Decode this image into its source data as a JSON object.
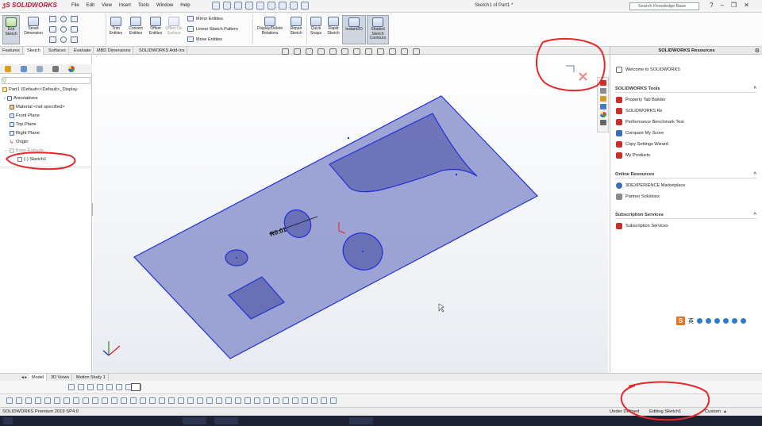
{
  "app": {
    "logo": "SOLIDWORKS",
    "doc_title": "Sketch1 of Part1 *"
  },
  "menu": [
    "File",
    "Edit",
    "View",
    "Insert",
    "Tools",
    "Window",
    "Help"
  ],
  "search": {
    "placeholder": "Search Knowledge Base"
  },
  "toolbar": {
    "exit_sketch": "Exit Sketch",
    "smart_dimension": "Smart Dimension",
    "trim_entities": "Trim Entities",
    "convert_entities": "Convert Entities",
    "offset_entities": "Offset Entities",
    "offset_on_surface": "Offset On Surface",
    "mirror_entities": "Mirror Entities",
    "linear_sketch_pattern": "Linear Sketch Pattern",
    "move_entities": "Move Entities",
    "display_delete_relations": "Display/Delete Relations",
    "repair_sketch": "Repair Sketch",
    "quick_snaps": "Quick Snaps",
    "rapid_sketch": "Rapid Sketch",
    "instant2d": "Instant2D",
    "shaded_sketch_contours": "Shaded Sketch Contours"
  },
  "cmd_tabs": [
    "Features",
    "Sketch",
    "Surfaces",
    "Evaluate",
    "MBD Dimensions",
    "SOLIDWORKS Add-Ins"
  ],
  "tree": {
    "part": "Part1  (Default<<Default>_Display",
    "annotations": "Annotations",
    "material": "Material <not specified>",
    "front_plane": "Front Plane",
    "top_plane": "Top Plane",
    "right_plane": "Right Plane",
    "origin": "Origin",
    "base_extrude": "Base-Extrude",
    "sketch": "(-) Sketch1"
  },
  "viewport": {
    "dimension_label": "R0.01"
  },
  "resources": {
    "title": "SOLIDWORKS Resources",
    "welcome": "Welcome to SOLIDWORKS",
    "tools_header": "SOLIDWORKS Tools",
    "tools": [
      "Property Tab Builder",
      "SOLIDWORKS Rx",
      "Performance Benchmark Test",
      "Compare My Score",
      "Copy Settings Wizard",
      "My Products"
    ],
    "online_header": "Online Resources",
    "online": [
      "3DEXPERIENCE Marketplace",
      "Partner Solutions"
    ],
    "subscription_header": "Subscription Services",
    "subscription": [
      "Subscription Services"
    ]
  },
  "tray": {
    "s5": "S",
    "lang": "英"
  },
  "bottom_tabs": [
    "Model",
    "3D Views",
    "Motion Study 1"
  ],
  "status": {
    "product": "SOLIDWORKS Premium 2019 SP4.0",
    "defined": "Under Defined",
    "editing": "Editing Sketch1",
    "units": "Custom"
  },
  "colors": {
    "sketch_blue": "#1f2fd6",
    "plate_fill": "#8d94cc",
    "red_annotation": "#e8262c",
    "brand_red": "#c8102e"
  }
}
